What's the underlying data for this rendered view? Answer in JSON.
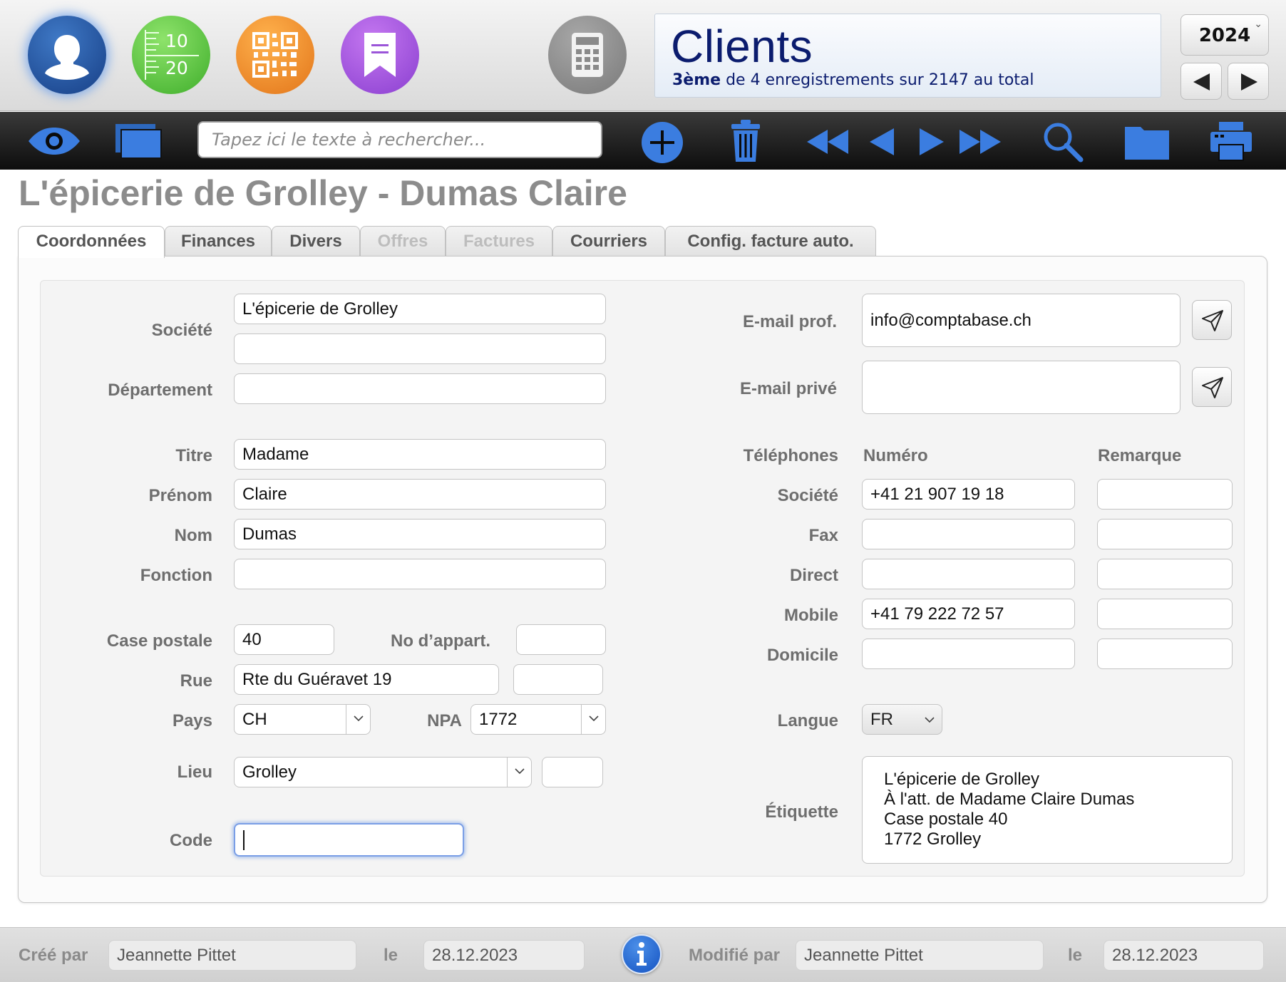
{
  "header": {
    "title": "Clients",
    "subtitle_bold": "3ème",
    "subtitle_rest": " de 4 enregistrements sur 2147 au total",
    "year": "2024",
    "list_icon_top": "10",
    "list_icon_bottom": "20"
  },
  "toolbar": {
    "search_placeholder": "Tapez ici le texte à rechercher..."
  },
  "record_title": "L'épicerie de Grolley - Dumas Claire",
  "tabs": [
    {
      "label": "Coordonnées",
      "state": "active"
    },
    {
      "label": "Finances",
      "state": "normal"
    },
    {
      "label": "Divers",
      "state": "normal"
    },
    {
      "label": "Offres",
      "state": "disabled"
    },
    {
      "label": "Factures",
      "state": "disabled"
    },
    {
      "label": "Courriers",
      "state": "normal"
    },
    {
      "label": "Config. facture auto.",
      "state": "normal"
    }
  ],
  "left": {
    "societe_label": "Société",
    "societe_1": "L'épicerie de Grolley",
    "societe_2": "",
    "departement_label": "Département",
    "departement": "",
    "titre_label": "Titre",
    "titre": "Madame",
    "prenom_label": "Prénom",
    "prenom": "Claire",
    "nom_label": "Nom",
    "nom": "Dumas",
    "fonction_label": "Fonction",
    "fonction": "",
    "case_postale_label": "Case postale",
    "case_postale": "40",
    "no_appart_label": "No d’appart.",
    "no_appart": "",
    "rue_label": "Rue",
    "rue": "Rte du Guéravet 19",
    "rue_extra": "",
    "pays_label": "Pays",
    "pays": "CH",
    "npa_label": "NPA",
    "npa": "1772",
    "lieu_label": "Lieu",
    "lieu": "Grolley",
    "lieu_extra": "",
    "code_label": "Code",
    "code": ""
  },
  "right": {
    "email_prof_label": "E-mail prof.",
    "email_prof": "info@comptabase.ch",
    "email_prive_label": "E-mail privé",
    "email_prive": "",
    "telephones_label": "Téléphones",
    "numero_header": "Numéro",
    "remarque_header": "Remarque",
    "phones": [
      {
        "label": "Société",
        "numero": "+41 21 907 19 18",
        "remarque": ""
      },
      {
        "label": "Fax",
        "numero": "",
        "remarque": ""
      },
      {
        "label": "Direct",
        "numero": "",
        "remarque": ""
      },
      {
        "label": "Mobile",
        "numero": "+41 79 222 72 57",
        "remarque": ""
      },
      {
        "label": "Domicile",
        "numero": "",
        "remarque": ""
      }
    ],
    "langue_label": "Langue",
    "langue": "FR",
    "etiquette_label": "Étiquette",
    "etiquette_lines": [
      "L'épicerie de Grolley",
      "À l'att. de Madame Claire Dumas",
      "Case postale 40",
      "1772 Grolley"
    ]
  },
  "footer": {
    "cree_par_label": "Créé par",
    "cree_par": "Jeannette Pittet",
    "le_label": "le",
    "cree_le": "28.12.2023",
    "modifie_par_label": "Modifié par",
    "modifie_par": "Jeannette Pittet",
    "modifie_le": "28.12.2023"
  },
  "colors": {
    "title_blue": "#0b1c6e",
    "accent_blue": "#3b7de0",
    "label_gray": "#6e6e6e",
    "toolbar_dark": "#1a1a1a"
  },
  "icons": [
    "contacts-icon",
    "numbered-list-icon",
    "qr-code-icon",
    "bookmark-icon",
    "calculator-icon",
    "eye-icon",
    "windows-icon",
    "add-icon",
    "trash-icon",
    "first-record-icon",
    "previous-record-icon",
    "next-record-icon",
    "last-record-icon",
    "search-icon",
    "folder-icon",
    "print-icon",
    "send-icon",
    "info-icon"
  ]
}
